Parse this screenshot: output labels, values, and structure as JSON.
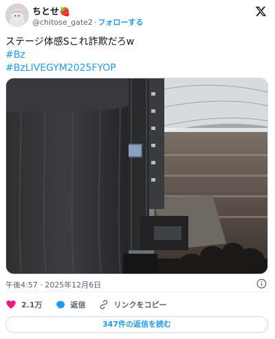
{
  "author": {
    "display_name": "ちとせ🍓",
    "handle": "@chitose_gate2",
    "separator": "·",
    "follow_label": "フォローする"
  },
  "tweet": {
    "text": "ステージ体感Sこれ詐欺だろw",
    "hashtags": [
      "#Bz",
      "#BzLIVEGYM2025FYOP"
    ]
  },
  "timestamp": "午後4:57 · 2025年12月6日",
  "actions": {
    "likes": "2.1万",
    "reply_label": "返信",
    "copy_link_label": "リンクをコピー"
  },
  "replies_button": "347件の返信を読む",
  "icons": [
    "x-logo-icon",
    "info-icon",
    "heart-icon",
    "reply-icon",
    "link-icon"
  ],
  "colors": {
    "accent": "#1d9bf0",
    "like": "#f91880",
    "text": "#0f1419",
    "muted": "#536471"
  }
}
